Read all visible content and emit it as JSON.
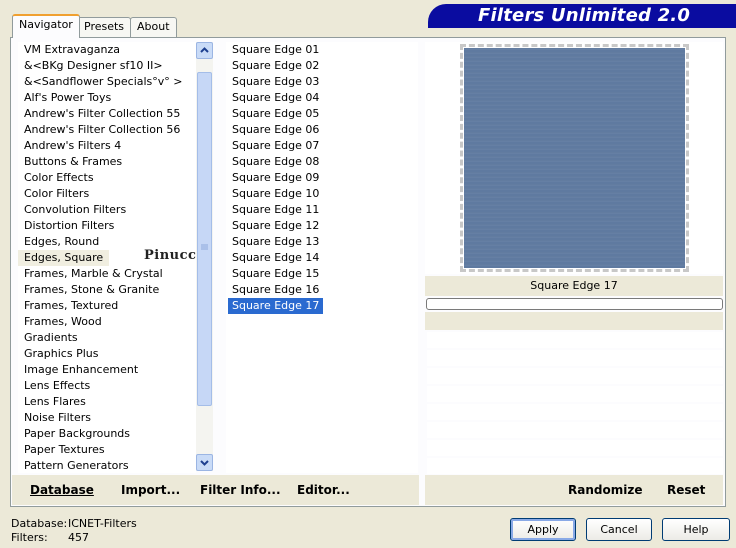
{
  "window": {
    "banner_title": "Filters Unlimited 2.0"
  },
  "tabs": [
    {
      "label": "Navigator",
      "active": true
    },
    {
      "label": "Presets",
      "active": false
    },
    {
      "label": "About",
      "active": false
    }
  ],
  "categories": {
    "items": [
      " VM Extravaganza",
      "&<BKg Designer sf10 II>",
      "&<Sandflower Specials°v° >",
      "Alf's Power Toys",
      "Andrew's Filter Collection 55",
      "Andrew's Filter Collection 56",
      "Andrew's Filters 4",
      "Buttons & Frames",
      "Color Effects",
      "Color Filters",
      "Convolution Filters",
      "Distortion Filters",
      "Edges, Round",
      "Edges, Square",
      "Frames, Marble & Crystal",
      "Frames, Stone & Granite",
      "Frames, Textured",
      "Frames, Wood",
      "Gradients",
      "Graphics Plus",
      "Image Enhancement",
      "Lens Effects",
      "Lens Flares",
      "Noise Filters",
      "Paper Backgrounds",
      "Paper Textures",
      "Pattern Generators"
    ],
    "highlighted_index": 13,
    "watermark": "Pinuccia"
  },
  "filters": {
    "items": [
      "Square Edge 01",
      "Square Edge 02",
      "Square Edge 03",
      "Square Edge 04",
      "Square Edge 05",
      "Square Edge 06",
      "Square Edge 07",
      "Square Edge 08",
      "Square Edge 09",
      "Square Edge 10",
      "Square Edge 11",
      "Square Edge 12",
      "Square Edge 13",
      "Square Edge 14",
      "Square Edge 15",
      "Square Edge 16",
      "Square Edge 17"
    ],
    "selected_index": 16
  },
  "preview": {
    "filter_name": "Square Edge 17",
    "preview_color": "#5f7aa0"
  },
  "bottom_left_buttons": {
    "database": "Database",
    "import": "Import...",
    "filter_info": "Filter Info...",
    "editor": "Editor..."
  },
  "bottom_right_buttons": {
    "randomize": "Randomize",
    "reset": "Reset"
  },
  "status": {
    "database_label": "Database:",
    "database_value": "ICNET-Filters",
    "filters_label": "Filters:",
    "filters_value": "457"
  },
  "dialog_buttons": {
    "apply": "Apply",
    "cancel": "Cancel",
    "help": "Help"
  },
  "colors": {
    "banner": "#0a0ca0",
    "selection": "#2a6ad0",
    "dialog_bg": "#ece9d8"
  }
}
